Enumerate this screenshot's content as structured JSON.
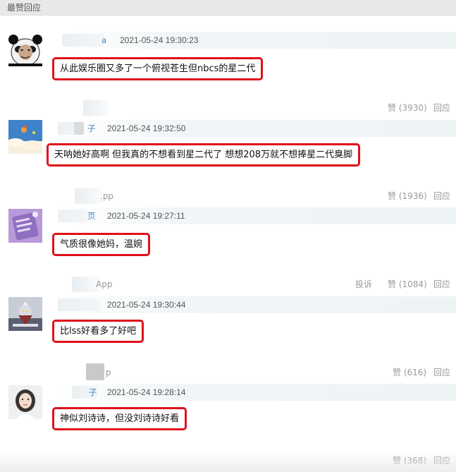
{
  "section": {
    "title": "最赞回应"
  },
  "comments": [
    {
      "username": "a",
      "time": "2021-05-24 19:30:23",
      "content": "从此娱乐圈又多了一个俯视苍生但nbcs的星二代",
      "source": "",
      "report_label": "",
      "like_label": "赞 (3930)",
      "reply_label": "回应",
      "avatar": "panda-meme-avatar"
    },
    {
      "username": "子",
      "time": "2021-05-24 19:32:50",
      "content": "天呐她好高啊 但我真的不想看到星二代了 想想208万就不想捧星二代臭脚",
      "source": ".pp",
      "report_label": "",
      "like_label": "赞 (1936)",
      "reply_label": "回应",
      "avatar": "sky-cartoon-avatar"
    },
    {
      "username": "页",
      "time": "2021-05-24 19:27:11",
      "content": "气质很像她妈，温婉",
      "source": "App",
      "report_label": "投诉",
      "like_label": "赞 (1084)",
      "reply_label": "回应",
      "avatar": "purple-note-avatar"
    },
    {
      "username": "",
      "time": "2021-05-24 19:30:44",
      "content": "比lss好看多了好吧",
      "source": "p",
      "report_label": "",
      "like_label": "赞 (616)",
      "reply_label": "回应",
      "avatar": "hero-figure-avatar"
    },
    {
      "username": "子",
      "time": "2021-05-24 19:28:14",
      "content": "神似刘诗诗，但没刘诗诗好看",
      "source": "",
      "report_label": "",
      "like_label": "赞 (368)",
      "reply_label": "回应",
      "avatar": "girl-portrait-avatar"
    }
  ],
  "colors": {
    "highlight_border": "#e0101a",
    "username": "#4a7fb8",
    "meta_text": "#555555",
    "action_text": "#999999",
    "header_bg": "#e8e8e8"
  }
}
